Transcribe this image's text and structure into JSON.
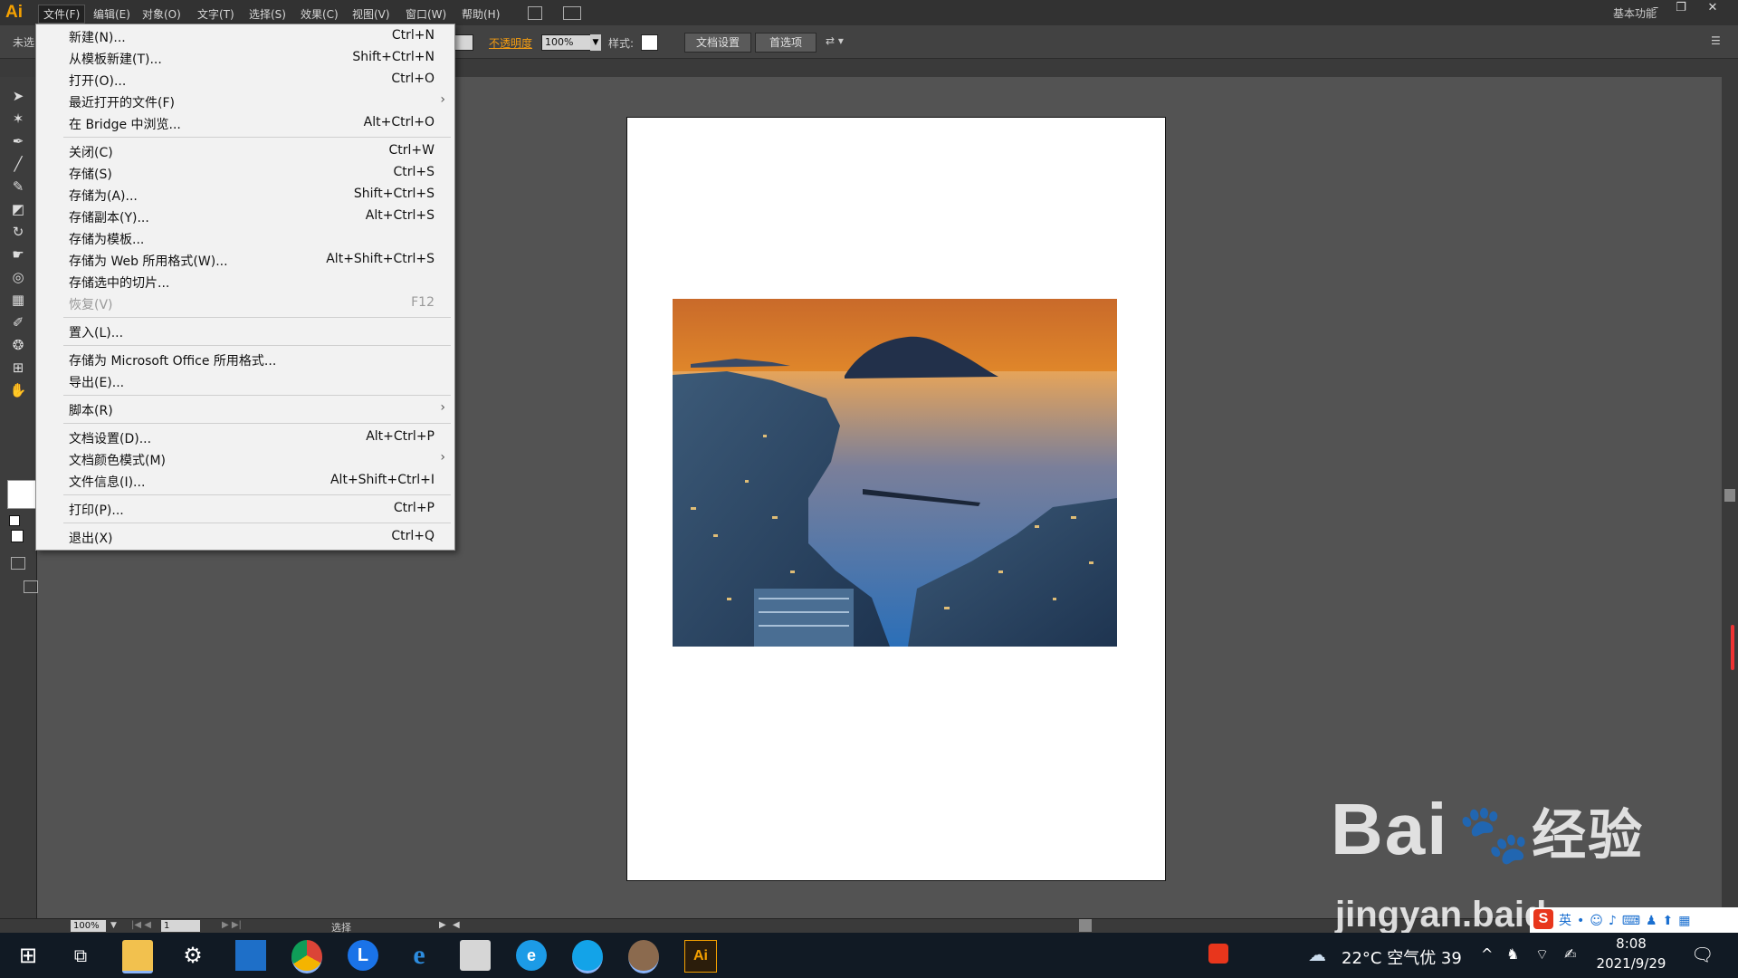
{
  "app": {
    "logo": "Ai",
    "workspace": "基本功能"
  },
  "menubar": {
    "items": [
      "文件(F)",
      "编辑(E)",
      "对象(O)",
      "文字(T)",
      "选择(S)",
      "效果(C)",
      "视图(V)",
      "窗口(W)",
      "帮助(H)"
    ]
  },
  "controlbar": {
    "unselected": "未选",
    "opacity_label": "不透明度",
    "opacity_value": "100%",
    "style_label": "样式:",
    "doc_setup": "文档设置",
    "prefs": "首选项"
  },
  "file_menu": {
    "items": [
      {
        "label": "新建(N)...",
        "shortcut": "Ctrl+N"
      },
      {
        "label": "从模板新建(T)...",
        "shortcut": "Shift+Ctrl+N"
      },
      {
        "label": "打开(O)...",
        "shortcut": "Ctrl+O"
      },
      {
        "label": "最近打开的文件(F)",
        "shortcut": ""
      },
      {
        "label": "在 Bridge 中浏览...",
        "shortcut": "Alt+Ctrl+O"
      },
      {
        "label": "关闭(C)",
        "shortcut": "Ctrl+W"
      },
      {
        "label": "存储(S)",
        "shortcut": "Ctrl+S"
      },
      {
        "label": "存储为(A)...",
        "shortcut": "Shift+Ctrl+S"
      },
      {
        "label": "存储副本(Y)...",
        "shortcut": "Alt+Ctrl+S"
      },
      {
        "label": "存储为模板...",
        "shortcut": ""
      },
      {
        "label": "存储为 Web 所用格式(W)...",
        "shortcut": "Alt+Shift+Ctrl+S"
      },
      {
        "label": "存储选中的切片...",
        "shortcut": ""
      },
      {
        "label": "恢复(V)",
        "shortcut": "F12"
      },
      {
        "label": "置入(L)...",
        "shortcut": ""
      },
      {
        "label": "存储为 Microsoft Office 所用格式...",
        "shortcut": ""
      },
      {
        "label": "导出(E)...",
        "shortcut": ""
      },
      {
        "label": "脚本(R)",
        "shortcut": ""
      },
      {
        "label": "文档设置(D)...",
        "shortcut": "Alt+Ctrl+P"
      },
      {
        "label": "文档颜色模式(M)",
        "shortcut": ""
      },
      {
        "label": "文件信息(I)...",
        "shortcut": "Alt+Shift+Ctrl+I"
      },
      {
        "label": "打印(P)...",
        "shortcut": "Ctrl+P"
      },
      {
        "label": "退出(X)",
        "shortcut": "Ctrl+Q"
      }
    ]
  },
  "statusbar": {
    "zoom": "100%",
    "page": "1",
    "tool": "选择"
  },
  "taskbar": {
    "weather": "22°C 空气优 39",
    "time": "8:08",
    "date": "2021/9/29"
  },
  "watermark": {
    "brand": "Bai",
    "brand_cn": "经验",
    "site": "jingyan.baidu"
  },
  "colors": {
    "accent": "#f5a100",
    "menu_bg": "#f2f2f2",
    "canvas": "#535353"
  }
}
